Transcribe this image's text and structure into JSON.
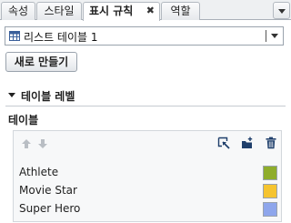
{
  "tabs": [
    {
      "label": "속성"
    },
    {
      "label": "스타일"
    },
    {
      "label": "표시 규칙",
      "close": "✖"
    },
    {
      "label": "역할"
    }
  ],
  "table_select": {
    "value": "리스트 테이블 1"
  },
  "new_button": {
    "label": "새로 만들기"
  },
  "section": {
    "title": "테이블 레벨"
  },
  "subsection": {
    "title": "테이블"
  },
  "toolbar": {
    "move_up": "arrow-up-icon",
    "move_down": "arrow-down-icon",
    "edit": "edit-icon",
    "add": "add-rule-icon",
    "delete": "trash-icon"
  },
  "rules": [
    {
      "label": "Athlete",
      "color": "#8fad2c"
    },
    {
      "label": "Movie Star",
      "color": "#f5c430"
    },
    {
      "label": "Super Hero",
      "color": "#8ea6ec"
    }
  ]
}
